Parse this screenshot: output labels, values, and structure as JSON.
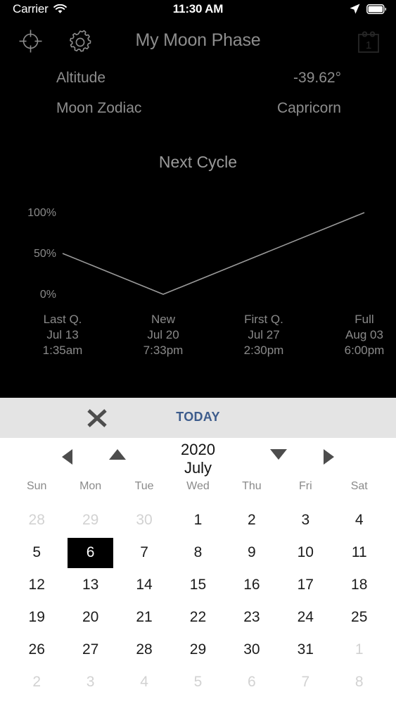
{
  "statusbar": {
    "carrier": "Carrier",
    "time": "11:30 AM",
    "wifi_icon": "wifi-icon",
    "location_icon": "location-arrow-icon",
    "battery_icon": "battery-full-icon"
  },
  "navbar": {
    "title": "My Moon Phase",
    "target_icon": "crosshair-target-icon",
    "gear_icon": "gear-icon",
    "calendar_icon": "calendar-icon",
    "calendar_icon_day": "1"
  },
  "info": {
    "rows": [
      {
        "label": "Altitude",
        "value": "-39.62°"
      },
      {
        "label": "Moon Zodiac",
        "value": "Capricorn"
      }
    ]
  },
  "chart_data": {
    "type": "line",
    "title": "Next Cycle",
    "xlabel": "",
    "ylabel": "",
    "ylim": [
      0,
      100
    ],
    "grid": false,
    "legend": null,
    "ytick_labels": [
      "100%",
      "50%",
      "0%"
    ],
    "ytick_values": [
      100,
      50,
      0
    ],
    "categories": [
      "Last Q.",
      "New",
      "First Q.",
      "Full"
    ],
    "x": [
      "Jul 13 1:35am",
      "Jul 20 7:33pm",
      "Jul 27 2:30pm",
      "Aug 03 6:00pm"
    ],
    "values": [
      50,
      0,
      50,
      100
    ],
    "points": [
      {
        "phase": "Last Q.",
        "date": "Jul 13",
        "time": "1:35am",
        "illumination": 50
      },
      {
        "phase": "New",
        "date": "Jul 20",
        "time": "7:33pm",
        "illumination": 0
      },
      {
        "phase": "First Q.",
        "date": "Jul 27",
        "time": "2:30pm",
        "illumination": 50
      },
      {
        "phase": "Full",
        "date": "Aug 03",
        "time": "6:00pm",
        "illumination": 100
      }
    ],
    "line_color": "#9a9a9a",
    "background": "#000000"
  },
  "calendar": {
    "close_label": "✕",
    "today_label": "TODAY",
    "year": "2020",
    "month": "July",
    "prev_arrow": "previous-month",
    "up_arrow": "next-year",
    "down_arrow": "previous-year",
    "next_arrow": "next-month",
    "weekdays": [
      "Sun",
      "Mon",
      "Tue",
      "Wed",
      "Thu",
      "Fri",
      "Sat"
    ],
    "selected_day": "6",
    "weeks": [
      [
        {
          "n": "28",
          "muted": true
        },
        {
          "n": "29",
          "muted": true
        },
        {
          "n": "30",
          "muted": true
        },
        {
          "n": "1",
          "muted": false
        },
        {
          "n": "2",
          "muted": false
        },
        {
          "n": "3",
          "muted": false
        },
        {
          "n": "4",
          "muted": false
        }
      ],
      [
        {
          "n": "5",
          "muted": false
        },
        {
          "n": "6",
          "muted": false,
          "selected": true
        },
        {
          "n": "7",
          "muted": false
        },
        {
          "n": "8",
          "muted": false
        },
        {
          "n": "9",
          "muted": false
        },
        {
          "n": "10",
          "muted": false
        },
        {
          "n": "11",
          "muted": false
        }
      ],
      [
        {
          "n": "12",
          "muted": false
        },
        {
          "n": "13",
          "muted": false
        },
        {
          "n": "14",
          "muted": false
        },
        {
          "n": "15",
          "muted": false
        },
        {
          "n": "16",
          "muted": false
        },
        {
          "n": "17",
          "muted": false
        },
        {
          "n": "18",
          "muted": false
        }
      ],
      [
        {
          "n": "19",
          "muted": false
        },
        {
          "n": "20",
          "muted": false
        },
        {
          "n": "21",
          "muted": false
        },
        {
          "n": "22",
          "muted": false
        },
        {
          "n": "23",
          "muted": false
        },
        {
          "n": "24",
          "muted": false
        },
        {
          "n": "25",
          "muted": false
        }
      ],
      [
        {
          "n": "26",
          "muted": false
        },
        {
          "n": "27",
          "muted": false
        },
        {
          "n": "28",
          "muted": false
        },
        {
          "n": "29",
          "muted": false
        },
        {
          "n": "30",
          "muted": false
        },
        {
          "n": "31",
          "muted": false
        },
        {
          "n": "1",
          "muted": true
        }
      ],
      [
        {
          "n": "2",
          "muted": true
        },
        {
          "n": "3",
          "muted": true
        },
        {
          "n": "4",
          "muted": true
        },
        {
          "n": "5",
          "muted": true
        },
        {
          "n": "6",
          "muted": true
        },
        {
          "n": "7",
          "muted": true
        },
        {
          "n": "8",
          "muted": true
        }
      ]
    ]
  },
  "colors": {
    "panel_bg": "#000000",
    "muted_text": "#8a8a8a",
    "accent_blue": "#3d5c8c",
    "toolbar_bg": "#e4e4e4",
    "selected_bg": "#000000"
  }
}
